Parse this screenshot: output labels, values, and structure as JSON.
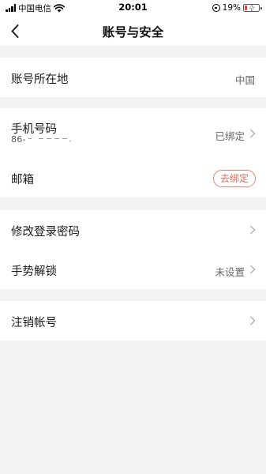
{
  "status_bar": {
    "carrier": "中国电信",
    "time": "20:01",
    "battery_percent": "19%",
    "battery_level": 0.19,
    "battery_color": "#e53935"
  },
  "nav": {
    "title": "账号与安全",
    "back_icon": "chevron-left-icon"
  },
  "rows": {
    "location": {
      "label": "账号所在地",
      "value": "中国"
    },
    "phone": {
      "label": "手机号码",
      "sub_prefix": "86-",
      "value": "已绑定"
    },
    "email": {
      "label": "邮箱",
      "action": "去绑定"
    },
    "change_password": {
      "label": "修改登录密码"
    },
    "gesture": {
      "label": "手势解锁",
      "value": "未设置"
    },
    "cancel_account": {
      "label": "注销帐号"
    }
  },
  "colors": {
    "background": "#f2f2f2",
    "card": "#ffffff",
    "accent": "#e06a5b"
  }
}
